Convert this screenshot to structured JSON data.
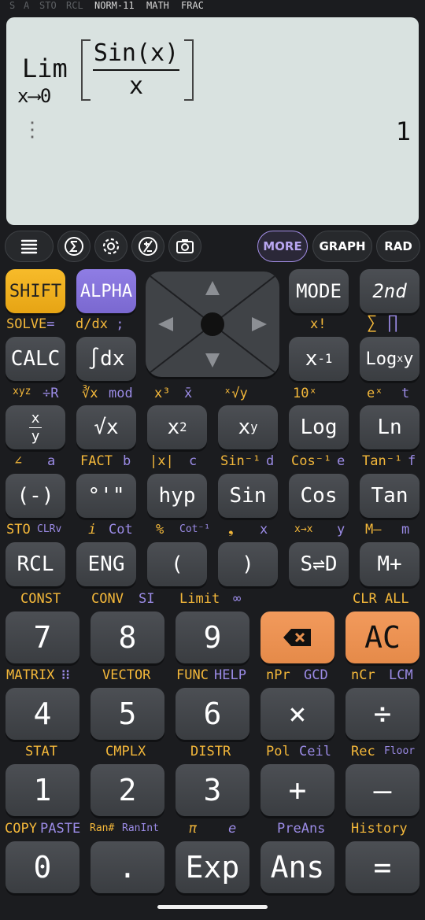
{
  "status": {
    "s": "S",
    "a": "A",
    "sto": "STO",
    "rcl": "RCL",
    "norm": "NORM-11",
    "math": "MATH",
    "frac": "FRAC"
  },
  "display": {
    "lim": "Lim",
    "lim_sub": "x⟶0",
    "numerator": "Sin(x)",
    "denominator": "x",
    "result": "1",
    "dots": "⋮"
  },
  "toolbar": {
    "more": "MORE",
    "graph": "GRAPH",
    "rad": "RAD"
  },
  "icons": {
    "menu": "menu-icon",
    "sigma": "sigma-icon",
    "settings": "gear-icon",
    "plusminus": "plus-minus-icon",
    "camera": "camera-icon"
  },
  "colors": {
    "shift": "#f4b83a",
    "alpha": "#9b8be6",
    "orange": "#e8914f",
    "display": "#d9e2e0"
  },
  "keys": {
    "shift": "SHIFT",
    "alpha": "ALPHA",
    "mode": "MODE",
    "second": "2nd",
    "calc": "CALC",
    "integral": "∫dx",
    "xinv": "x",
    "xinv_sup": "-1",
    "logxy": "Log",
    "logxy_sub": "x",
    "logxy_y": "y",
    "frac_num": "x",
    "frac_den": "y",
    "sqrt": "√x",
    "sq": "x",
    "sq_sup": "2",
    "pow": "x",
    "pow_sup": "y",
    "log": "Log",
    "ln": "Ln",
    "neg": "(-)",
    "dms": "°'\"",
    "hyp": "hyp",
    "sin": "Sin",
    "cos": "Cos",
    "tan": "Tan",
    "rcl": "RCL",
    "eng": "ENG",
    "lparen": "(",
    "rparen": ")",
    "sd": "S⇌D",
    "mplus": "M+",
    "n7": "7",
    "n8": "8",
    "n9": "9",
    "ac": "AC",
    "n4": "4",
    "n5": "5",
    "n6": "6",
    "mul": "×",
    "div": "÷",
    "n1": "1",
    "n2": "2",
    "n3": "3",
    "plus": "+",
    "minus": "–",
    "n0": "0",
    "dot": ".",
    "exp": "Exp",
    "ans": "Ans",
    "eq": "="
  },
  "labels": {
    "solve": "SOLVE",
    "solve_eq": "=",
    "ddx": "d/dx",
    "semi": ";",
    "xfact": "x!",
    "sum": "∑",
    "prod": "∏",
    "xyz": "xyz",
    "toR": "÷R",
    "cbrt": "∛x",
    "mod": "mod",
    "x3": "x³",
    "xbar": "x̄",
    "xroot": "ˣ√y",
    "tenx": "10ˣ",
    "ex": "eˣ",
    "t": "t",
    "angle": "∠",
    "a": "a",
    "fact": "FACT",
    "b": "b",
    "abs": "|x|",
    "c": "c",
    "asin": "Sin⁻¹",
    "d": "d",
    "acos": "Cos⁻¹",
    "e": "e",
    "atan": "Tan⁻¹",
    "f": "f",
    "sto": "STO",
    "clrv": "CLRv",
    "i": "i",
    "cot": "Cot",
    "pct": "%",
    "acot": "Cot⁻¹",
    "comma": "❟",
    "x": "x",
    "xyconv": "x→x",
    "y": "y",
    "mminus": "M–",
    "m": "m",
    "const": "CONST",
    "conv": "CONV",
    "si": "SI",
    "limit": "Limit",
    "inf": "∞",
    "clrall": "CLR ALL",
    "matrix": "MATRIX",
    "vector": "VECTOR",
    "func": "FUNC",
    "help": "HELP",
    "npr": "nPr",
    "gcd": "GCD",
    "ncr": "nCr",
    "lcm": "LCM",
    "stat": "STAT",
    "cmplx": "CMPLX",
    "distr": "DISTR",
    "pol": "Pol",
    "ceil": "Ceil",
    "rec": "Rec",
    "floor": "Floor",
    "copy": "COPY",
    "paste": "PASTE",
    "ran": "Ran#",
    "ranint": "RanInt",
    "pi": "π",
    "econst": "e",
    "preans": "PreAns",
    "history": "History"
  }
}
